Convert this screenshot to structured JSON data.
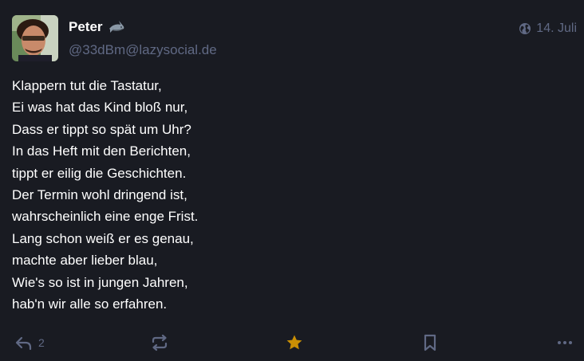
{
  "status": {
    "author": {
      "display_name": "Peter",
      "display_name_emoji": "shark-emoji",
      "handle": "@33dBm@lazysocial.de"
    },
    "visibility_icon": "globe-icon",
    "timestamp": "14. Juli",
    "content_lines": [
      "Klappern tut die Tastatur,",
      "Ei was hat das Kind bloß nur,",
      "Dass er tippt so spät um Uhr?",
      "In das Heft mit den Berichten,",
      "tippt er eilig die Geschichten.",
      "Der Termin wohl dringend ist,",
      "wahrscheinlich eine enge Frist.",
      "Lang schon weiß er es genau,",
      "machte aber lieber blau,",
      "Wie's so ist in jungen Jahren,",
      "hab'n wir alle so erfahren."
    ],
    "actions": {
      "reply_icon": "reply-icon",
      "reply_count": "2",
      "boost_icon": "boost-icon",
      "favourite_icon": "star-icon",
      "bookmark_icon": "bookmark-icon",
      "more_icon": "more-icon"
    },
    "colors": {
      "background": "#191b22",
      "muted": "#606984",
      "text": "#ffffff",
      "favourite_active": "#ca8f04"
    }
  }
}
